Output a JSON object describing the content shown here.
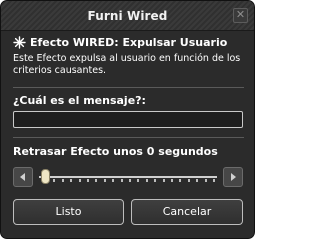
{
  "window": {
    "title": "Furni Wired",
    "close_glyph": "✕"
  },
  "effect": {
    "icon": "star-icon",
    "title": "Efecto WIRED: Expulsar Usuario",
    "description": "Este Efecto expulsa al usuario en función de los criterios causantes."
  },
  "message": {
    "label": "¿Cuál es el mensaje?:",
    "value": ""
  },
  "delay": {
    "label": "Retrasar Efecto unos 0 segundos",
    "value": 0,
    "slider_fraction": 0,
    "left_arrow_icon": "arrow-left-icon",
    "right_arrow_icon": "arrow-right-icon"
  },
  "buttons": {
    "ok": "Listo",
    "cancel": "Cancelar"
  }
}
